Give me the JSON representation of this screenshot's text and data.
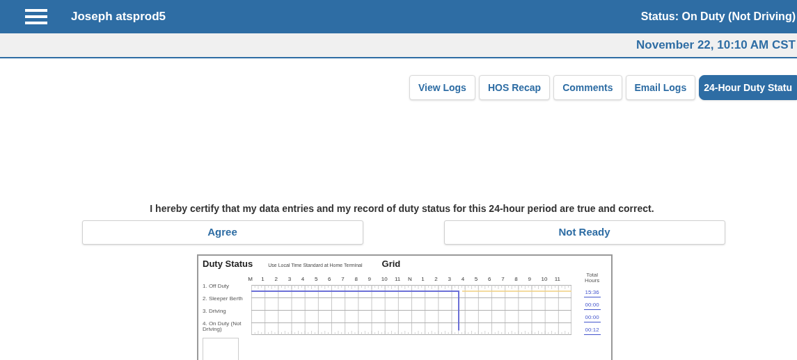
{
  "header": {
    "user": "Joseph atsprod5",
    "status": "Status: On Duty (Not Driving)",
    "datetime": "November 22, 10:10 AM CST"
  },
  "tabs": [
    {
      "label": "View Logs",
      "selected": false
    },
    {
      "label": "HOS Recap",
      "selected": false
    },
    {
      "label": "Comments",
      "selected": false
    },
    {
      "label": "Email Logs",
      "selected": false
    },
    {
      "label": "24-Hour Duty Statu",
      "selected": true
    }
  ],
  "certification": {
    "statement": "I hereby certify that my data entries and my record of duty status for this 24-hour period are true and correct.",
    "buttons": [
      "Agree",
      "Not Ready"
    ]
  },
  "log_sheet": {
    "title": "Duty Status",
    "subtitle": "Use Local Time Standard at Home Terminal",
    "grid_title": "Grid",
    "hours": [
      "M",
      "1",
      "2",
      "3",
      "4",
      "5",
      "6",
      "7",
      "8",
      "9",
      "10",
      "11",
      "N",
      "1",
      "2",
      "3",
      "4",
      "5",
      "6",
      "7",
      "8",
      "9",
      "10",
      "11"
    ],
    "total_heading": "Total Hours",
    "rows": [
      {
        "label": "1. Off Duty",
        "total": "15:36"
      },
      {
        "label": "2. Sleeper Berth",
        "total": "00:00"
      },
      {
        "label": "3. Driving",
        "total": "00:00"
      },
      {
        "label": "4. On Duty (Not Driving)",
        "total": "00:12"
      }
    ]
  }
}
